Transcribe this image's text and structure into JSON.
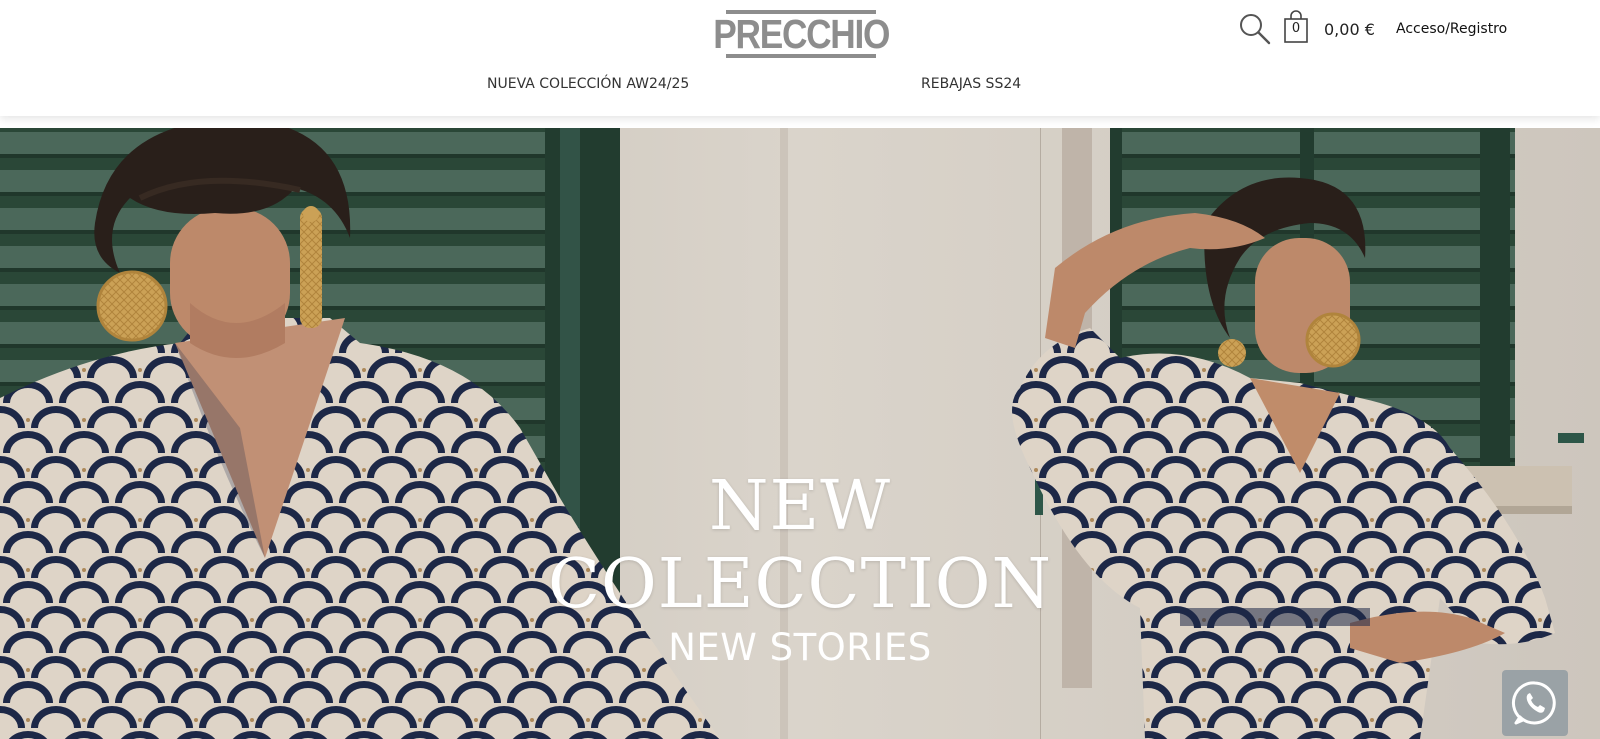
{
  "brand": {
    "logo_text": "PRECCHIO"
  },
  "header": {
    "cart_count": "0",
    "cart_total": "0,00 €",
    "login_label": "Acceso/Registro"
  },
  "nav": {
    "items": [
      {
        "label": "NUEVA COLECCIÓN AW24/25"
      },
      {
        "label": "REBAJAS SS24"
      }
    ]
  },
  "hero": {
    "title": "NEW\nCOLECCTION",
    "subtitle": "NEW STORIES"
  },
  "icons": {
    "search": "search-icon",
    "cart": "shopping-bag-icon",
    "whatsapp": "whatsapp-icon"
  },
  "colors": {
    "logo": "#8d8d8d",
    "shutter_green": "#2f4d3c",
    "dress_navy": "#1f2a4a",
    "dress_cream": "#e8ddd0",
    "earring_gold": "#d4a85a",
    "whatsapp_bg": "#9aa2a6"
  }
}
